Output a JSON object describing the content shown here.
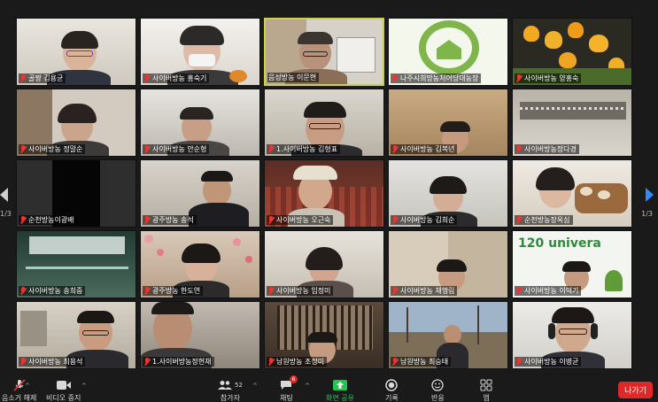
{
  "participants": [
    {
      "name": "골짱 김용균",
      "muted": true,
      "active": false
    },
    {
      "name": "사이버방농 홍숙기",
      "muted": true,
      "active": false
    },
    {
      "name": "음성방농 이문현",
      "muted": false,
      "active": true
    },
    {
      "name": "나주시희망농처어당대농장",
      "muted": true,
      "active": false
    },
    {
      "name": "사이버방농 양홍숙",
      "muted": true,
      "active": false
    },
    {
      "name": "사이버방농 정말순",
      "muted": true,
      "active": false
    },
    {
      "name": "사이버방농 안순형",
      "muted": true,
      "active": false
    },
    {
      "name": "1.사이버방농 김형표",
      "muted": true,
      "active": false
    },
    {
      "name": "사이버방농 김복년",
      "muted": true,
      "active": false
    },
    {
      "name": "사이버방농정다경",
      "muted": true,
      "active": false
    },
    {
      "name": "순천방농이광배",
      "muted": true,
      "active": false
    },
    {
      "name": "광주방농 송석",
      "muted": true,
      "active": false
    },
    {
      "name": "사이버방농 오근숙",
      "muted": true,
      "active": false
    },
    {
      "name": "사이버방농 김희순",
      "muted": true,
      "active": false
    },
    {
      "name": "순천방농장옥심",
      "muted": true,
      "active": false
    },
    {
      "name": "사이버방농 송희중",
      "muted": true,
      "active": false
    },
    {
      "name": "광주방농 한도연",
      "muted": true,
      "active": false
    },
    {
      "name": "사이버방농 임정미",
      "muted": true,
      "active": false
    },
    {
      "name": "사이버방농 채행림",
      "muted": true,
      "active": false
    },
    {
      "name": "사이버방농 이덕기",
      "muted": true,
      "active": false
    },
    {
      "name": "사이버방농 최용석",
      "muted": true,
      "active": false
    },
    {
      "name": "1.사이버방농정현채",
      "muted": true,
      "active": false
    },
    {
      "name": "남원방농 조정미",
      "muted": true,
      "active": false
    },
    {
      "name": "남원방농 최승태",
      "muted": true,
      "active": false
    },
    {
      "name": "사이버방농 이병균",
      "muted": true,
      "active": false
    }
  ],
  "tile4_logo_text": "120 univera",
  "page_indicator_left": "1/3",
  "page_indicator_right": "1/3",
  "toolbar": {
    "unmute_label": "음소거 해제",
    "video_label": "비디오 중지",
    "participants_label": "참가자",
    "participants_count": "52",
    "chat_label": "채팅",
    "chat_badge": "6",
    "share_label": "화면 공유",
    "record_label": "기록",
    "reactions_label": "반응",
    "apps_label": "앱",
    "leave_label": "나가기"
  },
  "colors": {
    "active_border": "#c8d34a",
    "share_green": "#23c552",
    "leave_red": "#e02828",
    "next_arrow_blue": "#2d8cff"
  }
}
